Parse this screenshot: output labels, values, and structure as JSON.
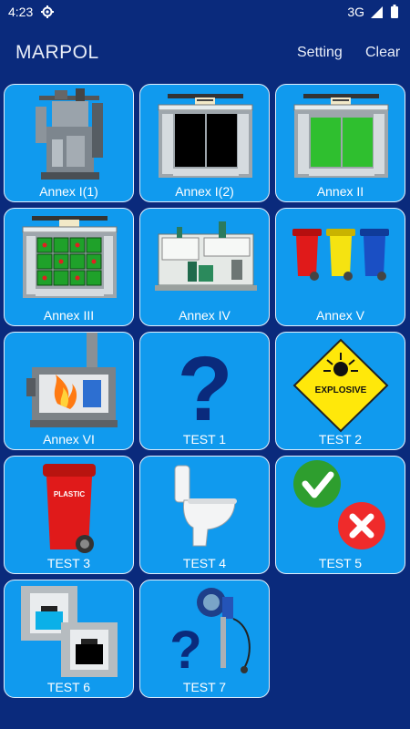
{
  "status_bar": {
    "time": "4:23",
    "network": "3G"
  },
  "app_bar": {
    "title": "MARPOL",
    "actions": [
      "Setting",
      "Clear"
    ]
  },
  "tiles": [
    {
      "label": "Annex I(1)",
      "icon": "engine-icon"
    },
    {
      "label": "Annex I(2)",
      "icon": "ship-tanks-black-icon"
    },
    {
      "label": "Annex II",
      "icon": "ship-tanks-green-icon"
    },
    {
      "label": "Annex III",
      "icon": "ship-cargo-drums-icon"
    },
    {
      "label": "Annex IV",
      "icon": "sewage-plant-icon"
    },
    {
      "label": "Annex V",
      "icon": "garbage-bins-icon"
    },
    {
      "label": "Annex VI",
      "icon": "incinerator-icon"
    },
    {
      "label": "TEST 1",
      "icon": "question-mark-icon"
    },
    {
      "label": "TEST 2",
      "icon": "explosive-sign-icon",
      "sign_text": "EXPLOSIVE"
    },
    {
      "label": "TEST 3",
      "icon": "plastic-bin-icon",
      "bin_text": "PLASTIC"
    },
    {
      "label": "TEST 4",
      "icon": "toilet-icon"
    },
    {
      "label": "TEST 5",
      "icon": "check-cross-icon"
    },
    {
      "label": "TEST 6",
      "icon": "tank-diagrams-icon"
    },
    {
      "label": "TEST 7",
      "icon": "level-gauge-question-icon"
    }
  ],
  "colors": {
    "background": "#0a2a7c",
    "tile": "#109aee",
    "tile_border": "#e3eefb"
  }
}
